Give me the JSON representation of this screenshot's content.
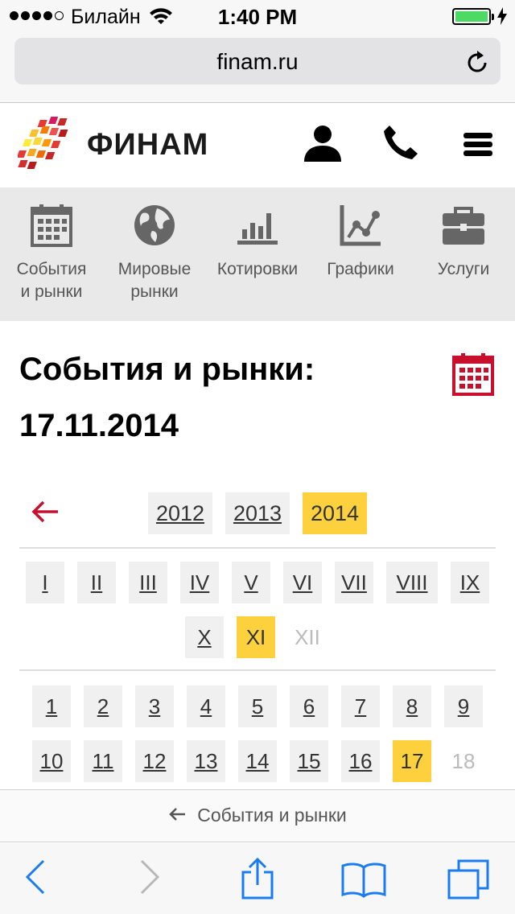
{
  "status_bar": {
    "carrier": "Билайн",
    "time": "1:40 PM",
    "battery_level": 1.0,
    "signal_bars": 4
  },
  "browser": {
    "url": "finam.ru"
  },
  "site": {
    "logo_text": "ФИНАМ"
  },
  "nav": {
    "items": [
      {
        "label": "События\nи рынки",
        "icon": "calendar-icon"
      },
      {
        "label": "Мировые\nрынки",
        "icon": "globe-icon"
      },
      {
        "label": "Котировки",
        "icon": "bar-chart-icon"
      },
      {
        "label": "Графики",
        "icon": "line-chart-icon"
      },
      {
        "label": "Услуги",
        "icon": "briefcase-icon"
      }
    ]
  },
  "page": {
    "title": "События и рынки: 17.11.2014"
  },
  "calendar": {
    "years": [
      "2012",
      "2013",
      "2014"
    ],
    "selected_year": "2014",
    "months": [
      "I",
      "II",
      "III",
      "IV",
      "V",
      "VI",
      "VII",
      "VIII",
      "IX",
      "X",
      "XI",
      "XII"
    ],
    "selected_month": "XI",
    "disabled_months": [
      "XII"
    ],
    "days": [
      "1",
      "2",
      "3",
      "4",
      "5",
      "6",
      "7",
      "8",
      "9",
      "10",
      "11",
      "12",
      "13",
      "14",
      "15",
      "16",
      "17",
      "18"
    ],
    "selected_day": "17",
    "disabled_days": [
      "18"
    ]
  },
  "back_link": {
    "label": "События и рынки"
  },
  "colors": {
    "accent_yellow": "#fdd13e",
    "brand_red": "#c8102e",
    "ios_blue": "#1a7cf0"
  }
}
